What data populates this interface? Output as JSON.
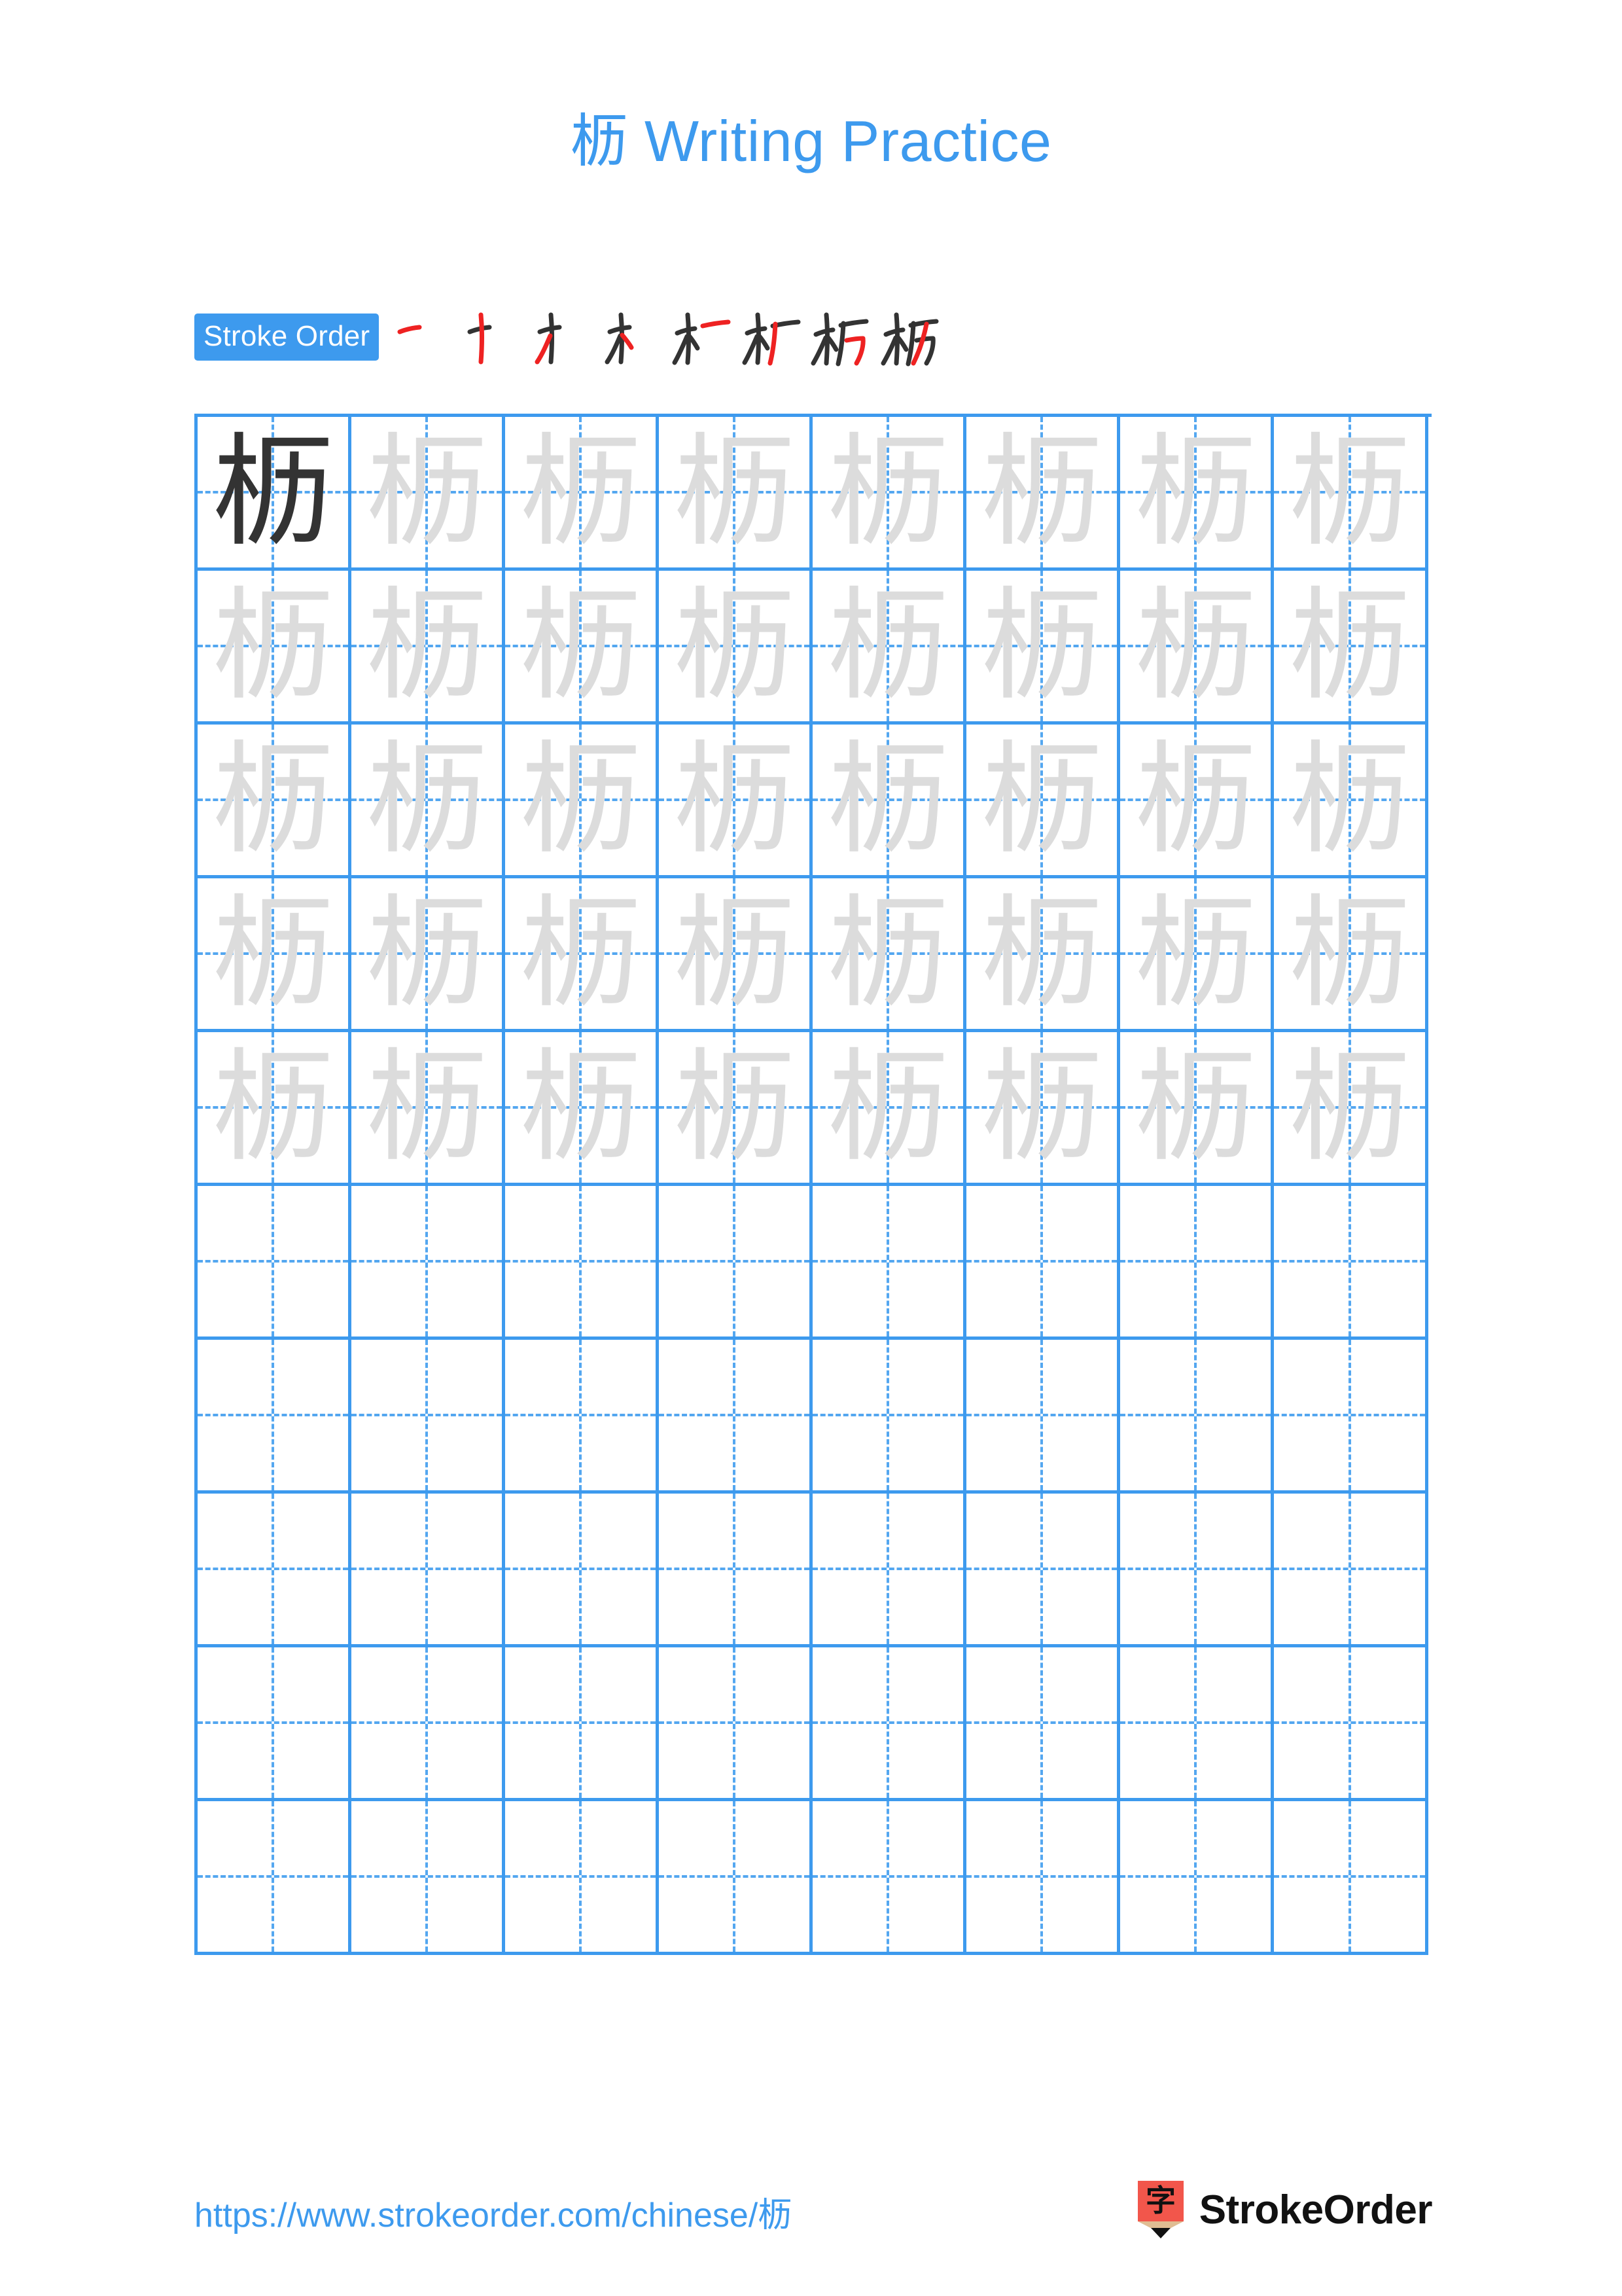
{
  "document": {
    "character": "枥",
    "title_suffix": " Writing Practice",
    "title_full": "枥 Writing Practice"
  },
  "colors": {
    "accent_blue": "#3d9aee",
    "grid_line": "#3d9aee",
    "grid_guide": "#54a7f0",
    "char_solid": "#333333",
    "char_traced": "#dcdcdc",
    "stroke_new": "#ee2222",
    "stroke_old": "#333333",
    "logo_red": "#f2564b",
    "logo_tip": "#e0bd93",
    "page_background": "#ffffff"
  },
  "stroke_order": {
    "badge_label": "Stroke Order",
    "stroke_count": 8,
    "steps": [
      {
        "index": 1,
        "name": "stroke-step-1",
        "new_stroke": "héng (horizontal)"
      },
      {
        "index": 2,
        "name": "stroke-step-2",
        "new_stroke": "shù (vertical)"
      },
      {
        "index": 3,
        "name": "stroke-step-3",
        "new_stroke": "piě (left-falling)"
      },
      {
        "index": 4,
        "name": "stroke-step-4",
        "new_stroke": "diǎn (dot)"
      },
      {
        "index": 5,
        "name": "stroke-step-5",
        "new_stroke": "héng (horizontal)"
      },
      {
        "index": 6,
        "name": "stroke-step-6",
        "new_stroke": "piě (left-falling)"
      },
      {
        "index": 7,
        "name": "stroke-step-7",
        "new_stroke": "héng zhé gōu (horizontal-bend-hook)"
      },
      {
        "index": 8,
        "name": "stroke-step-8",
        "new_stroke": "piě (left-falling)"
      }
    ]
  },
  "practice_grid": {
    "columns": 8,
    "rows": 10,
    "filled_rows": 5,
    "empty_rows": 5,
    "cells": [
      [
        "solid",
        "traced",
        "traced",
        "traced",
        "traced",
        "traced",
        "traced",
        "traced"
      ],
      [
        "traced",
        "traced",
        "traced",
        "traced",
        "traced",
        "traced",
        "traced",
        "traced"
      ],
      [
        "traced",
        "traced",
        "traced",
        "traced",
        "traced",
        "traced",
        "traced",
        "traced"
      ],
      [
        "traced",
        "traced",
        "traced",
        "traced",
        "traced",
        "traced",
        "traced",
        "traced"
      ],
      [
        "traced",
        "traced",
        "traced",
        "traced",
        "traced",
        "traced",
        "traced",
        "traced"
      ],
      [
        "empty",
        "empty",
        "empty",
        "empty",
        "empty",
        "empty",
        "empty",
        "empty"
      ],
      [
        "empty",
        "empty",
        "empty",
        "empty",
        "empty",
        "empty",
        "empty",
        "empty"
      ],
      [
        "empty",
        "empty",
        "empty",
        "empty",
        "empty",
        "empty",
        "empty",
        "empty"
      ],
      [
        "empty",
        "empty",
        "empty",
        "empty",
        "empty",
        "empty",
        "empty",
        "empty"
      ],
      [
        "empty",
        "empty",
        "empty",
        "empty",
        "empty",
        "empty",
        "empty",
        "empty"
      ]
    ]
  },
  "footer": {
    "url": "https://www.strokeorder.com/chinese/枥",
    "brand_name": "StrokeOrder",
    "brand_mark_glyph": "字"
  }
}
